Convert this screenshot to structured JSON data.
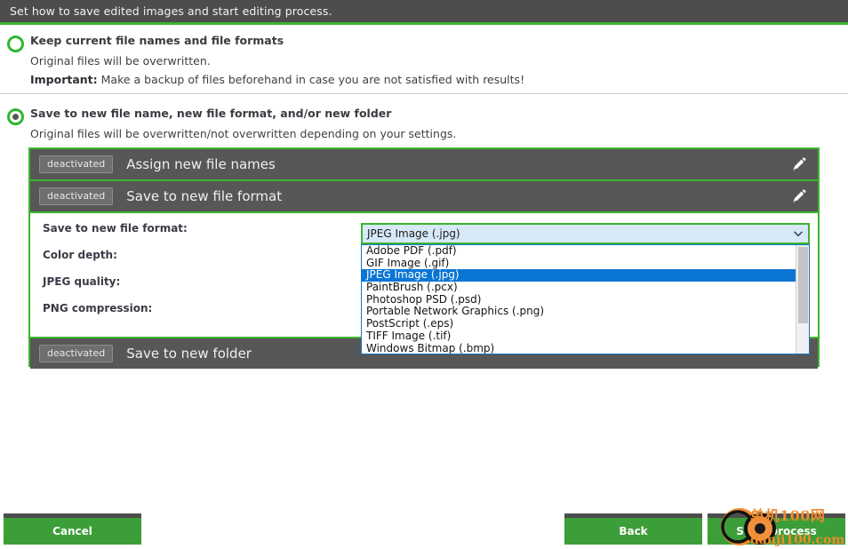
{
  "header": {
    "title": "Set how to save edited images and start editing process."
  },
  "options": [
    {
      "id": "keep-current",
      "selected": false,
      "title": "Keep current file names and file formats",
      "line1": "Original files will be overwritten.",
      "line2_bold": "Important:",
      "line2_rest": " Make a backup of files beforehand in case you are not satisfied with results!"
    },
    {
      "id": "save-new",
      "selected": true,
      "title": "Save to new file name, new file format, and/or new folder",
      "line1": "Original files will be overwritten/not overwritten depending on your settings."
    }
  ],
  "group": {
    "strips": [
      {
        "badge": "deactivated",
        "label": "Assign new file names",
        "edit_icon": "pencil-icon"
      },
      {
        "badge": "deactivated",
        "label": "Save to new file format",
        "edit_icon": "pencil-icon"
      }
    ],
    "footer_strip": {
      "badge": "deactivated",
      "label": "Save to new folder"
    },
    "settings_labels": [
      "Save to new file format:",
      "Color depth:",
      "JPEG quality:",
      "PNG compression:"
    ]
  },
  "combobox": {
    "value": "JPEG Image (.jpg)",
    "arrow_icon": "chevron-down-icon",
    "options": [
      "Adobe PDF (.pdf)",
      "GIF Image (.gif)",
      "JPEG Image (.jpg)",
      "PaintBrush (.pcx)",
      "Photoshop PSD (.psd)",
      "Portable Network Graphics (.png)",
      "PostScript (.eps)",
      "TIFF Image (.tif)",
      "Windows Bitmap (.bmp)"
    ],
    "selected_index": 2
  },
  "buttons": {
    "cancel": "Cancel",
    "back": "Back",
    "start": "Start process"
  },
  "watermark": {
    "line1": "单机100网",
    "line2": "danji100.com"
  },
  "colors": {
    "accent_green": "#3cb52e",
    "button_green": "#3c9e38",
    "panel_dark": "#575757",
    "header_dark": "#4d4d4d",
    "select_blue": "#0a75d4",
    "combo_fill": "#d7e8f7",
    "watermark_orange": "#f08a2a"
  }
}
